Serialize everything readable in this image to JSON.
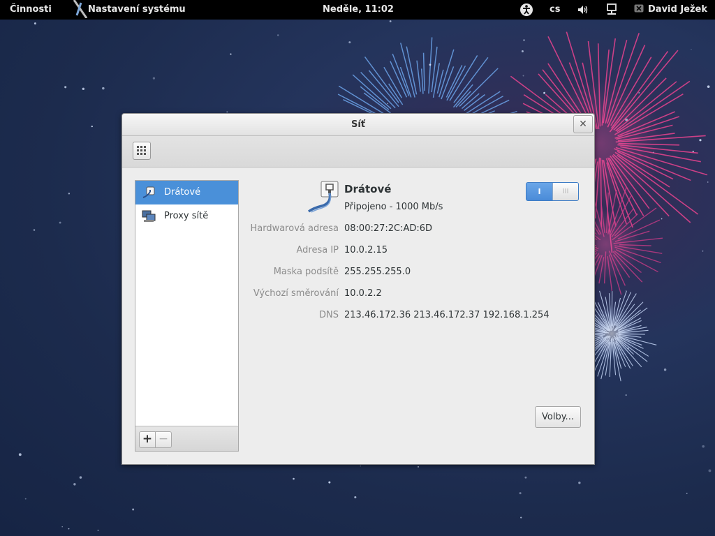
{
  "topbar": {
    "activities": "Činnosti",
    "app_name": "Nastavení systému",
    "clock": "Neděle, 11:02",
    "language": "cs",
    "user": "David Ježek",
    "icons": [
      "accessibility-icon",
      "volume-icon",
      "network-icon",
      "chat-icon"
    ]
  },
  "window": {
    "title": "Síť",
    "sidebar": {
      "items": [
        {
          "label": "Drátové",
          "icon": "wired-network-icon",
          "selected": true
        },
        {
          "label": "Proxy sítě",
          "icon": "network-proxy-icon",
          "selected": false
        }
      ],
      "add_label": "+",
      "remove_label": "−"
    },
    "device": {
      "name": "Drátové",
      "status": "Připojeno - 1000 Mb/s",
      "switch_on": "I",
      "switch_off": "III",
      "details": [
        {
          "key": "Hardwarová adresa",
          "value": "08:00:27:2C:AD:6D"
        },
        {
          "key": "Adresa IP",
          "value": "10.0.2.15"
        },
        {
          "key": "Maska podsítě",
          "value": "255.255.255.0"
        },
        {
          "key": "Výchozí směrování",
          "value": "10.0.2.2"
        },
        {
          "key": "DNS",
          "value": "213.46.172.36 213.46.172.37 192.168.1.254"
        }
      ]
    },
    "options_label": "Volby..."
  },
  "colors": {
    "selection": "#4a90d9",
    "topbar": "#000000",
    "window_bg": "#ededed"
  }
}
